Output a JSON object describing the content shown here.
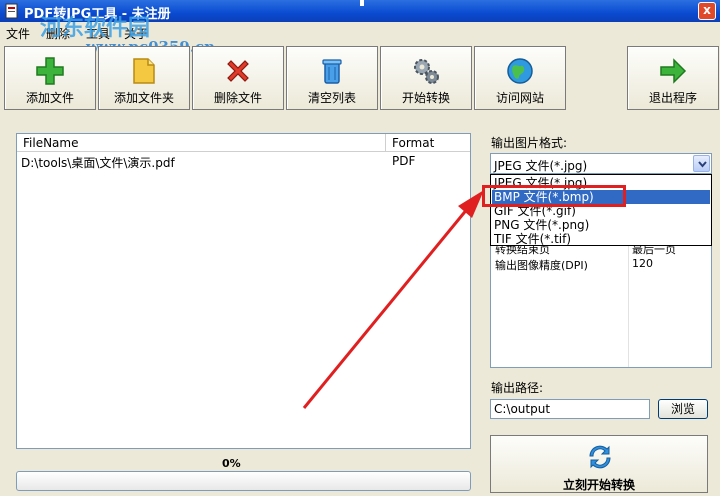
{
  "window": {
    "title": "PDF转JPG工具 - 未注册",
    "close_glyph": "x"
  },
  "watermark": {
    "text": "河东软件园",
    "url": "www.pc0359.cn"
  },
  "menu": [
    {
      "label": "文件"
    },
    {
      "label": "删除"
    },
    {
      "label": "工具"
    },
    {
      "label": "关于"
    }
  ],
  "toolbar": {
    "add_file": "添加文件",
    "add_folder": "添加文件夹",
    "delete_file": "删除文件",
    "clear_list": "清空列表",
    "start_convert": "开始转换",
    "visit_site": "访问网站",
    "exit": "退出程序"
  },
  "file_list": {
    "columns": [
      "FileName",
      "Format"
    ],
    "rows": [
      {
        "name": "D:\\tools\\桌面\\文件\\演示.pdf",
        "format": "PDF"
      }
    ]
  },
  "progress": {
    "text": "0%",
    "value": 0
  },
  "output_format": {
    "label": "输出图片格式:",
    "selected": "JPEG 文件(*.jpg)",
    "options": [
      "JPEG 文件(*.jpg)",
      "BMP 文件(*.bmp)",
      "GIF 文件(*.gif)",
      "PNG 文件(*.png)",
      "TIF 文件(*.tif)"
    ],
    "highlighted_index": 1
  },
  "settings": [
    {
      "key": "转换结束页",
      "value": "最后一页"
    },
    {
      "key": "输出图像精度(DPI)",
      "value": "120"
    }
  ],
  "output_path": {
    "label": "输出路径:",
    "value": "C:\\output",
    "browse": "浏览"
  },
  "start_button": {
    "label": "立刻开始转换"
  },
  "colors": {
    "highlight": "#e02020",
    "selection": "#316ac5",
    "titlebar": "#0a4bd1"
  }
}
